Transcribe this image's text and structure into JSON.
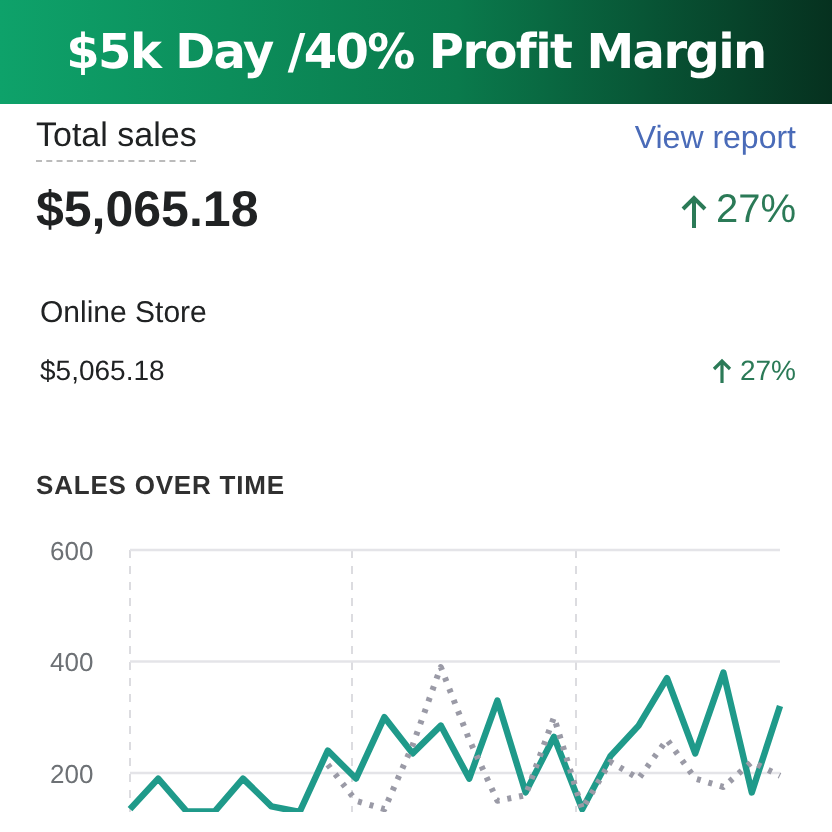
{
  "banner": {
    "title": "$5k Day /40% Profit Margin"
  },
  "summary": {
    "label": "Total sales",
    "link": "View report",
    "value": "$5,065.18",
    "change": "27%"
  },
  "channels": [
    {
      "name": "Online Store",
      "value": "$5,065.18",
      "change": "27%"
    }
  ],
  "sales_over_time": {
    "heading": "SALES OVER TIME",
    "chart_data": {
      "type": "line",
      "grid": true,
      "ylim": [
        130,
        600
      ],
      "yticks": [
        200,
        400,
        600
      ],
      "series": [
        {
          "color": "#1f9a8a",
          "line_style": "solid",
          "values": [
            135,
            190,
            131,
            131,
            190,
            140,
            130,
            240,
            190,
            300,
            235,
            285,
            190,
            330,
            165,
            265,
            135,
            230,
            285,
            370,
            235,
            380,
            165,
            320
          ]
        },
        {
          "color": "#9a9aa6",
          "line_style": "dotted",
          "values": [
            null,
            null,
            null,
            null,
            null,
            null,
            null,
            215,
            150,
            135,
            250,
            390,
            260,
            150,
            160,
            300,
            135,
            220,
            190,
            260,
            190,
            175,
            220,
            195
          ]
        }
      ]
    }
  }
}
